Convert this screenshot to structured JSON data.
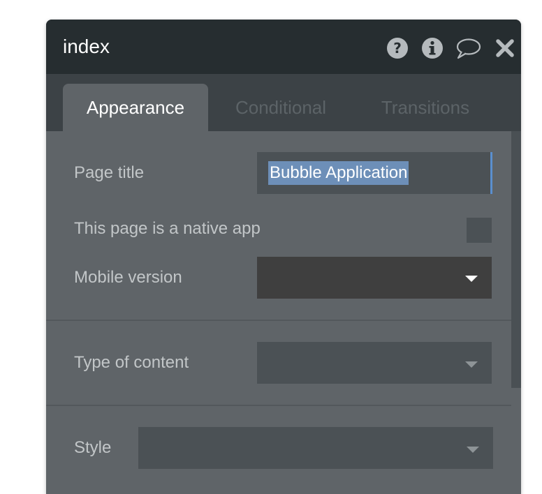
{
  "panel": {
    "title": "index",
    "icons": [
      "question-circle-icon",
      "info-circle-icon",
      "comment-icon",
      "close-icon"
    ]
  },
  "tabs": [
    {
      "label": "Appearance",
      "active": true
    },
    {
      "label": "Conditional",
      "active": false
    },
    {
      "label": "Transitions",
      "active": false
    }
  ],
  "fields": {
    "page_title": {
      "label": "Page title",
      "value": "Bubble Application"
    },
    "native_app": {
      "label": "This page is a native app",
      "checked": false
    },
    "mobile_version": {
      "label": "Mobile version",
      "value": ""
    },
    "type_of_content": {
      "label": "Type of content",
      "value": ""
    },
    "style": {
      "label": "Style",
      "value": ""
    }
  },
  "colors": {
    "header_bg": "#262d30",
    "panel_bg": "#5f6468",
    "tabs_bg": "#3c4246",
    "selection": "#6d8fb8",
    "focus_border": "#5b8fcf"
  }
}
